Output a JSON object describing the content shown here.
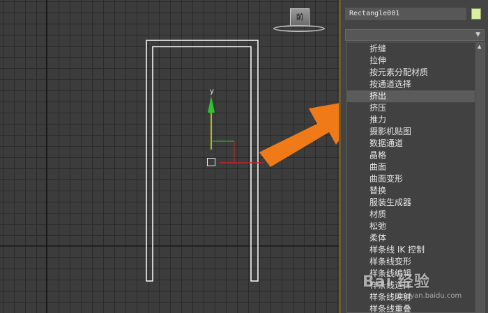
{
  "viewport": {
    "viewcube_label": "前",
    "gizmo_axis_label": "y",
    "shape": "door-outline rectangle"
  },
  "panel": {
    "object_name": "Rectangle001",
    "object_color": "#d8f0a0",
    "dropdown_value": "",
    "modifier_list": [
      {
        "label": "折缝",
        "selected": false
      },
      {
        "label": "拉伸",
        "selected": false
      },
      {
        "label": "按元素分配材质",
        "selected": false
      },
      {
        "label": "按通道选择",
        "selected": false
      },
      {
        "label": "挤出",
        "selected": true
      },
      {
        "label": "挤压",
        "selected": false
      },
      {
        "label": "推力",
        "selected": false
      },
      {
        "label": "摄影机贴图",
        "selected": false
      },
      {
        "label": "数据通道",
        "selected": false
      },
      {
        "label": "晶格",
        "selected": false
      },
      {
        "label": "曲面",
        "selected": false
      },
      {
        "label": "曲面变形",
        "selected": false
      },
      {
        "label": "替换",
        "selected": false
      },
      {
        "label": "服装生成器",
        "selected": false
      },
      {
        "label": "材质",
        "selected": false
      },
      {
        "label": "松弛",
        "selected": false
      },
      {
        "label": "柔体",
        "selected": false
      },
      {
        "label": "样条线 IK 控制",
        "selected": false
      },
      {
        "label": "样条线变形",
        "selected": false
      },
      {
        "label": "样条线编辑",
        "selected": false
      },
      {
        "label": "样条线选择",
        "selected": false
      },
      {
        "label": "样条线映射",
        "selected": false
      },
      {
        "label": "样条线重叠",
        "selected": false
      }
    ]
  },
  "annotation": {
    "arrow_color": "#f07a18",
    "arrow_target": "挤出"
  },
  "watermark": {
    "text": "Bai 经验",
    "url": "jingyan.baidu.com"
  },
  "colors": {
    "viewport_bg": "#3c3c3c",
    "grid_line": "#2b2b2b",
    "panel_bg": "#444444",
    "selection": "#5b5b5b"
  }
}
